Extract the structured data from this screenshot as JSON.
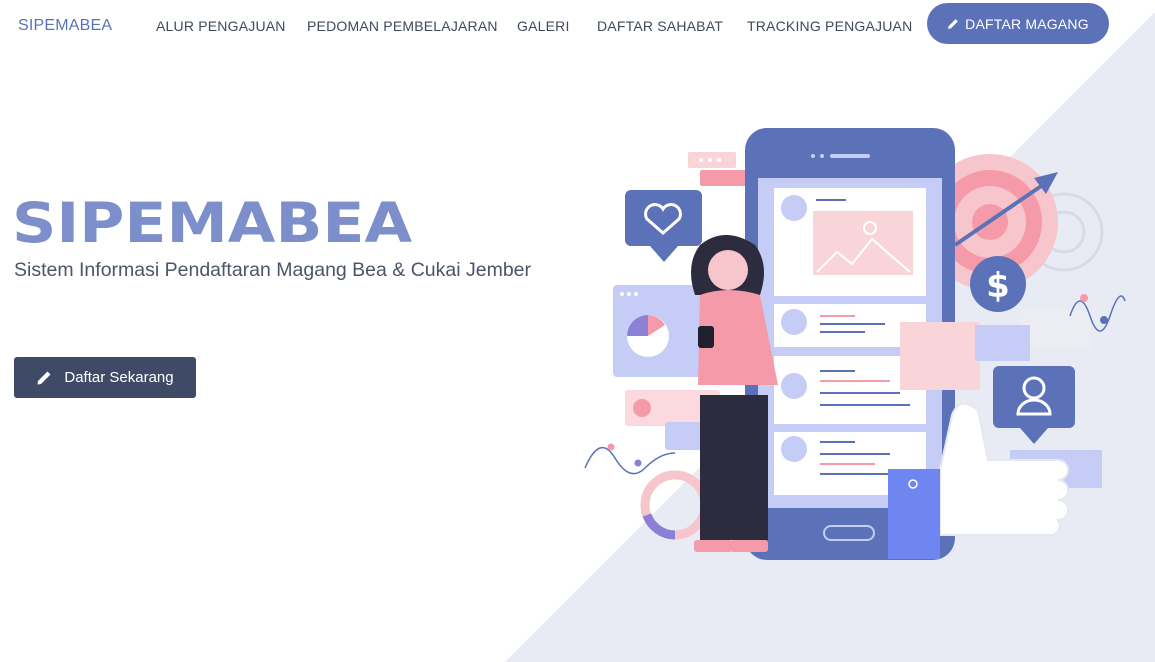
{
  "nav": {
    "brand": "SIPEMABEA",
    "links": [
      "ALUR PENGAJUAN",
      "PEDOMAN PEMBELAJARAN",
      "GALERI",
      "DAFTAR SAHABAT",
      "TRACKING PENGAJUAN"
    ],
    "cta_label": "DAFTAR MAGANG",
    "cta_icon": "pencil-icon"
  },
  "hero": {
    "title": "SIPEMABEA",
    "subtitle": "Sistem Informasi Pendaftaran Magang Bea & Cukai Jember",
    "button_label": "Daftar Sekarang",
    "button_icon": "pencil-icon"
  },
  "colors": {
    "brand": "#5b72b8",
    "title": "#7d8fca",
    "hero_button": "#3f4b66",
    "background_accent": "#e8ebf4",
    "pink_accent": "#f7b8c2"
  }
}
